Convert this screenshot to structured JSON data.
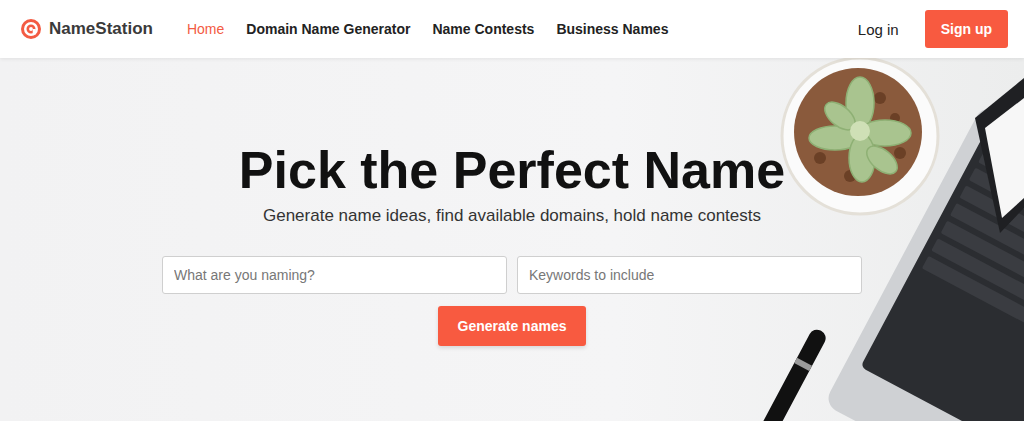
{
  "brand": {
    "name": "NameStation"
  },
  "nav": {
    "items": [
      {
        "label": "Home",
        "selected": true
      },
      {
        "label": "Domain Name Generator",
        "selected": false
      },
      {
        "label": "Name Contests",
        "selected": false
      },
      {
        "label": "Business Names",
        "selected": false
      }
    ]
  },
  "auth": {
    "login": "Log in",
    "signup": "Sign up"
  },
  "hero": {
    "title": "Pick the Perfect Name",
    "subtitle": "Generate name ideas, find available domains, hold name contests",
    "fields": [
      {
        "placeholder": "What are you naming?"
      },
      {
        "placeholder": "Keywords to include"
      }
    ],
    "button": "Generate names"
  }
}
